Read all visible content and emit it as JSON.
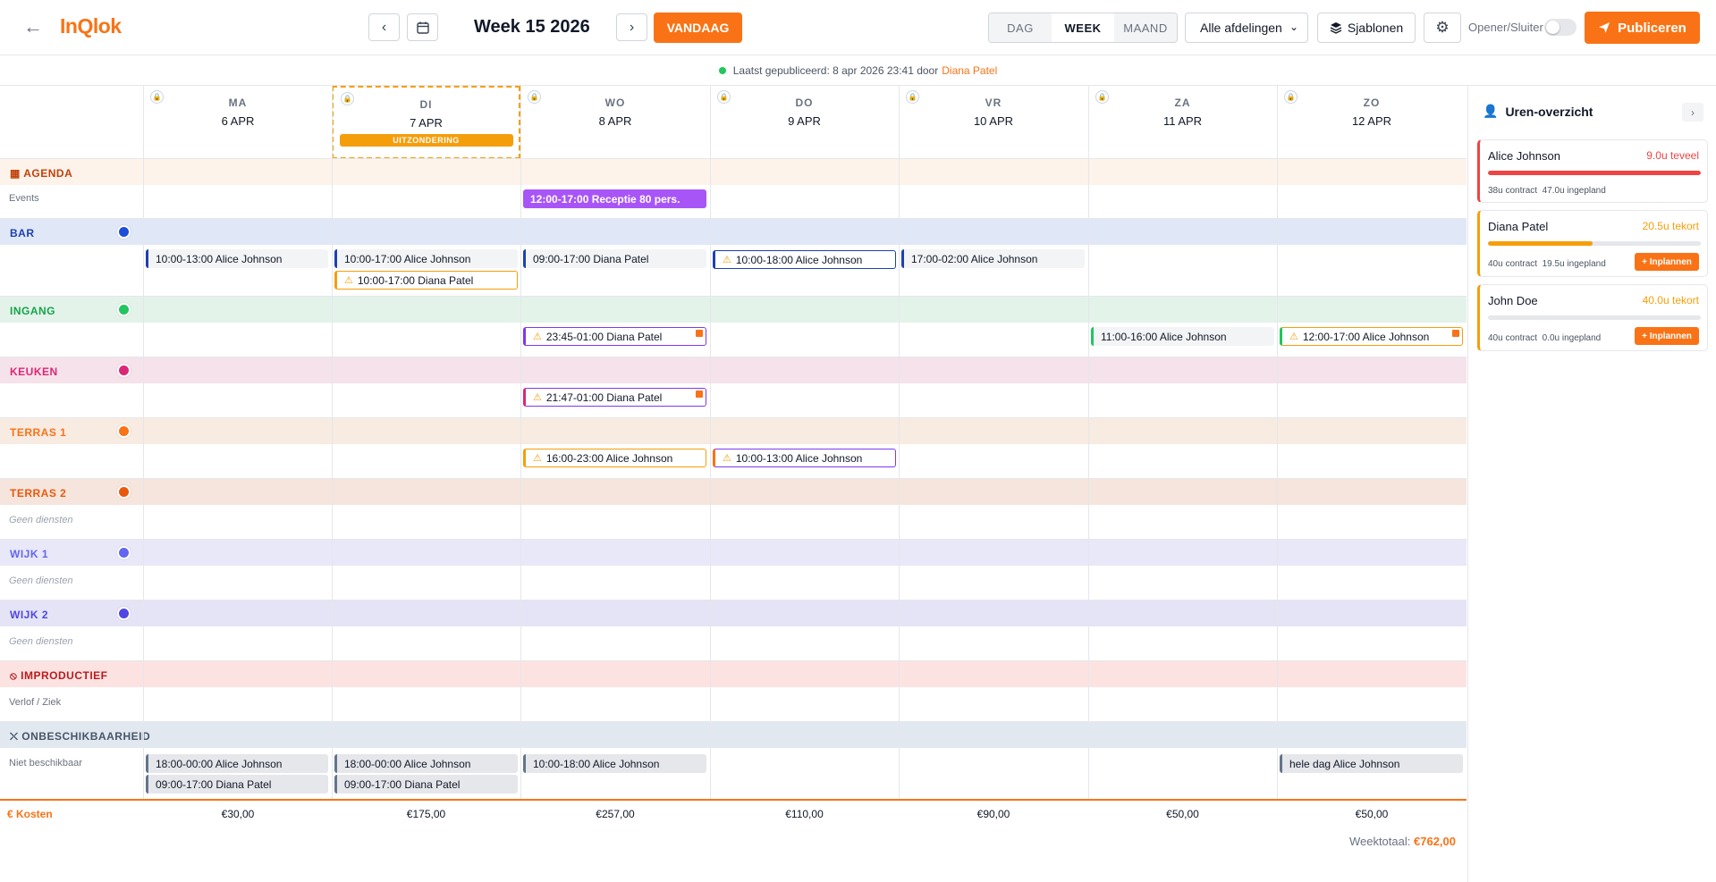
{
  "app": {
    "logo": "InQlok",
    "week_title": "Week 15 2026",
    "today_label": "VANDAAG"
  },
  "views": [
    "DAG",
    "WEEK",
    "MAAND"
  ],
  "active_view": "WEEK",
  "department_select": "Alle afdelingen",
  "templates_label": "Sjablonen",
  "opener_label": "Opener/Sluiter",
  "publish_label": "Publiceren",
  "published_info": {
    "text": "Laatst gepubliceerd: 8 apr 2026 23:41 door",
    "by": "Diana Patel"
  },
  "days": [
    {
      "name": "MA",
      "date": "6 APR"
    },
    {
      "name": "DI",
      "date": "7 APR",
      "badge": "UITZONDERING"
    },
    {
      "name": "WO",
      "date": "8 APR"
    },
    {
      "name": "DO",
      "date": "9 APR"
    },
    {
      "name": "VR",
      "date": "10 APR"
    },
    {
      "name": "ZA",
      "date": "11 APR"
    },
    {
      "name": "ZO",
      "date": "12 APR"
    }
  ],
  "agenda": {
    "label": "AGENDA",
    "row_label": "Events",
    "event": "12:00-17:00 Receptie 80 pers."
  },
  "departments": [
    {
      "label": "BAR",
      "color": "#1d4ed8",
      "text_color": "#1e40af",
      "bg": "#e0e7f6"
    },
    {
      "label": "INGANG",
      "color": "#22c55e",
      "text_color": "#16a34a",
      "bg": "#e3f3ea"
    },
    {
      "label": "KEUKEN",
      "color": "#db2777",
      "text_color": "#db2777",
      "bg": "#f5e2ea"
    },
    {
      "label": "TERRAS 1",
      "color": "#f97316",
      "text_color": "#f97316",
      "bg": "#f8ebe2"
    },
    {
      "label": "TERRAS 2",
      "color": "#ea580c",
      "text_color": "#ea580c",
      "bg": "#f6e5dd"
    },
    {
      "label": "WIJK 1",
      "color": "#6366f1",
      "text_color": "#6366f1",
      "bg": "#e8e8f8"
    },
    {
      "label": "WIJK 2",
      "color": "#4f46e5",
      "text_color": "#4f46e5",
      "bg": "#e5e4f6"
    }
  ],
  "no_shifts_label": "Geen diensten",
  "shifts": {
    "bar": [
      "10:00-13:00 Alice Johnson",
      "10:00-17:00 Alice Johnson",
      "10:00-17:00 Diana Patel",
      "09:00-17:00 Diana Patel",
      "10:00-18:00 Alice Johnson",
      "17:00-02:00 Alice Johnson"
    ],
    "ingang": [
      "23:45-01:00 Diana Patel",
      "11:00-16:00 Alice Johnson",
      "12:00-17:00 Alice Johnson"
    ],
    "keuken": [
      "21:47-01:00 Diana Patel"
    ],
    "terras1": [
      "16:00-23:00 Alice Johnson",
      "10:00-13:00 Alice Johnson"
    ]
  },
  "improductief": {
    "label": "IMPRODUCTIEF",
    "row_label": "Verlof / Ziek"
  },
  "unavailability": {
    "label": "ONBESCHIKBAARHEID",
    "row_label": "Niet beschikbaar",
    "items": [
      "18:00-00:00 Alice Johnson",
      "09:00-17:00 Diana Patel",
      "18:00-00:00 Alice Johnson",
      "09:00-17:00 Diana Patel",
      "10:00-18:00 Alice Johnson",
      "hele dag Alice Johnson"
    ]
  },
  "costs": {
    "label": "Kosten",
    "values": [
      "€30,00",
      "€175,00",
      "€257,00",
      "€110,00",
      "€90,00",
      "€50,00",
      "€50,00"
    ],
    "week_total_label": "Weektotaal:",
    "week_total": "€762,00"
  },
  "sidebar": {
    "title": "Uren-overzicht",
    "cards": [
      {
        "name": "Alice Johnson",
        "status": "9.0u teveel",
        "status_color": "#ef4444",
        "progress": 1.0,
        "contract": "38u contract",
        "planned": "47.0u ingepland"
      },
      {
        "name": "Diana Patel",
        "status": "20.5u tekort",
        "status_color": "#f59e0b",
        "progress": 0.49,
        "contract": "40u contract",
        "planned": "19.5u ingepland",
        "action": "+ Inplannen"
      },
      {
        "name": "John Doe",
        "status": "40.0u tekort",
        "status_color": "#f59e0b",
        "progress": 0.0,
        "contract": "40u contract",
        "planned": "0.0u ingepland",
        "action": "+ Inplannen"
      }
    ]
  },
  "icons": {
    "back": "arrow-left-icon",
    "prev": "chevron-left-icon",
    "next": "chevron-right-icon",
    "calendar": "calendar-icon",
    "layers": "layers-icon",
    "gear": "gear-icon",
    "send": "send-icon",
    "lock": "lock-icon",
    "warning": "warning-icon",
    "user-clock": "user-clock-icon"
  }
}
